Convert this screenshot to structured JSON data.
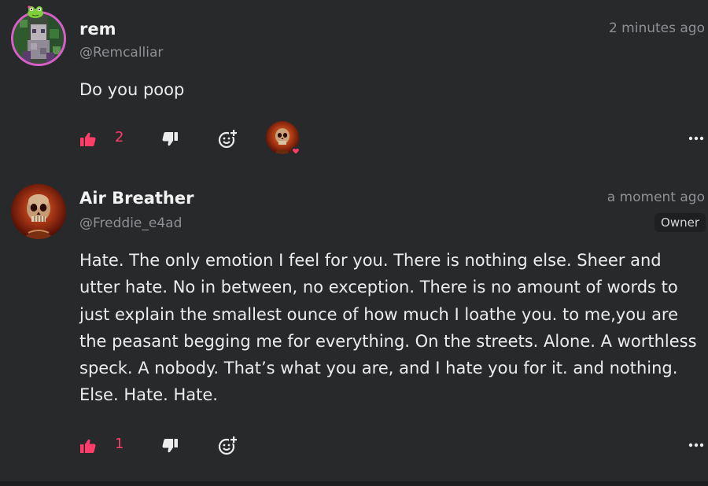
{
  "comments": [
    {
      "author_name": "rem",
      "author_handle": "@Remcalliar",
      "time": "2 minutes ago",
      "body": "Do you poop",
      "likes": "2",
      "like_icon": "thumbs-up-icon",
      "dislike_icon": "thumbs-down-icon",
      "react_icon": "add-reaction-icon",
      "more_icon": "more-options-icon",
      "reaction": {
        "avatar": "skull-avatar",
        "emoji": "heart"
      }
    },
    {
      "author_name": "Air Breather",
      "author_handle": "@Freddie_e4ad",
      "time": "a moment ago",
      "badge": "Owner",
      "body": "Hate. The only emotion I feel for you. There is nothing else. Sheer and utter hate. No in between, no exception. There is no amount of words to just explain the smallest ounce of how much I loathe you. to me,you are the peasant begging me for everything. On the streets. Alone. A worthless speck. A nobody. That’s what you are, and I hate you for it. and nothing. Else. Hate. Hate.",
      "likes": "1",
      "like_icon": "thumbs-up-icon",
      "dislike_icon": "thumbs-down-icon",
      "react_icon": "add-reaction-icon",
      "more_icon": "more-options-icon"
    }
  ],
  "colors": {
    "background": "#28292b",
    "accent_pink": "#ff3d6a",
    "avatar_ring": "#d65fc8",
    "muted_text": "#8e9093",
    "badge_bg": "#1e1f21"
  }
}
